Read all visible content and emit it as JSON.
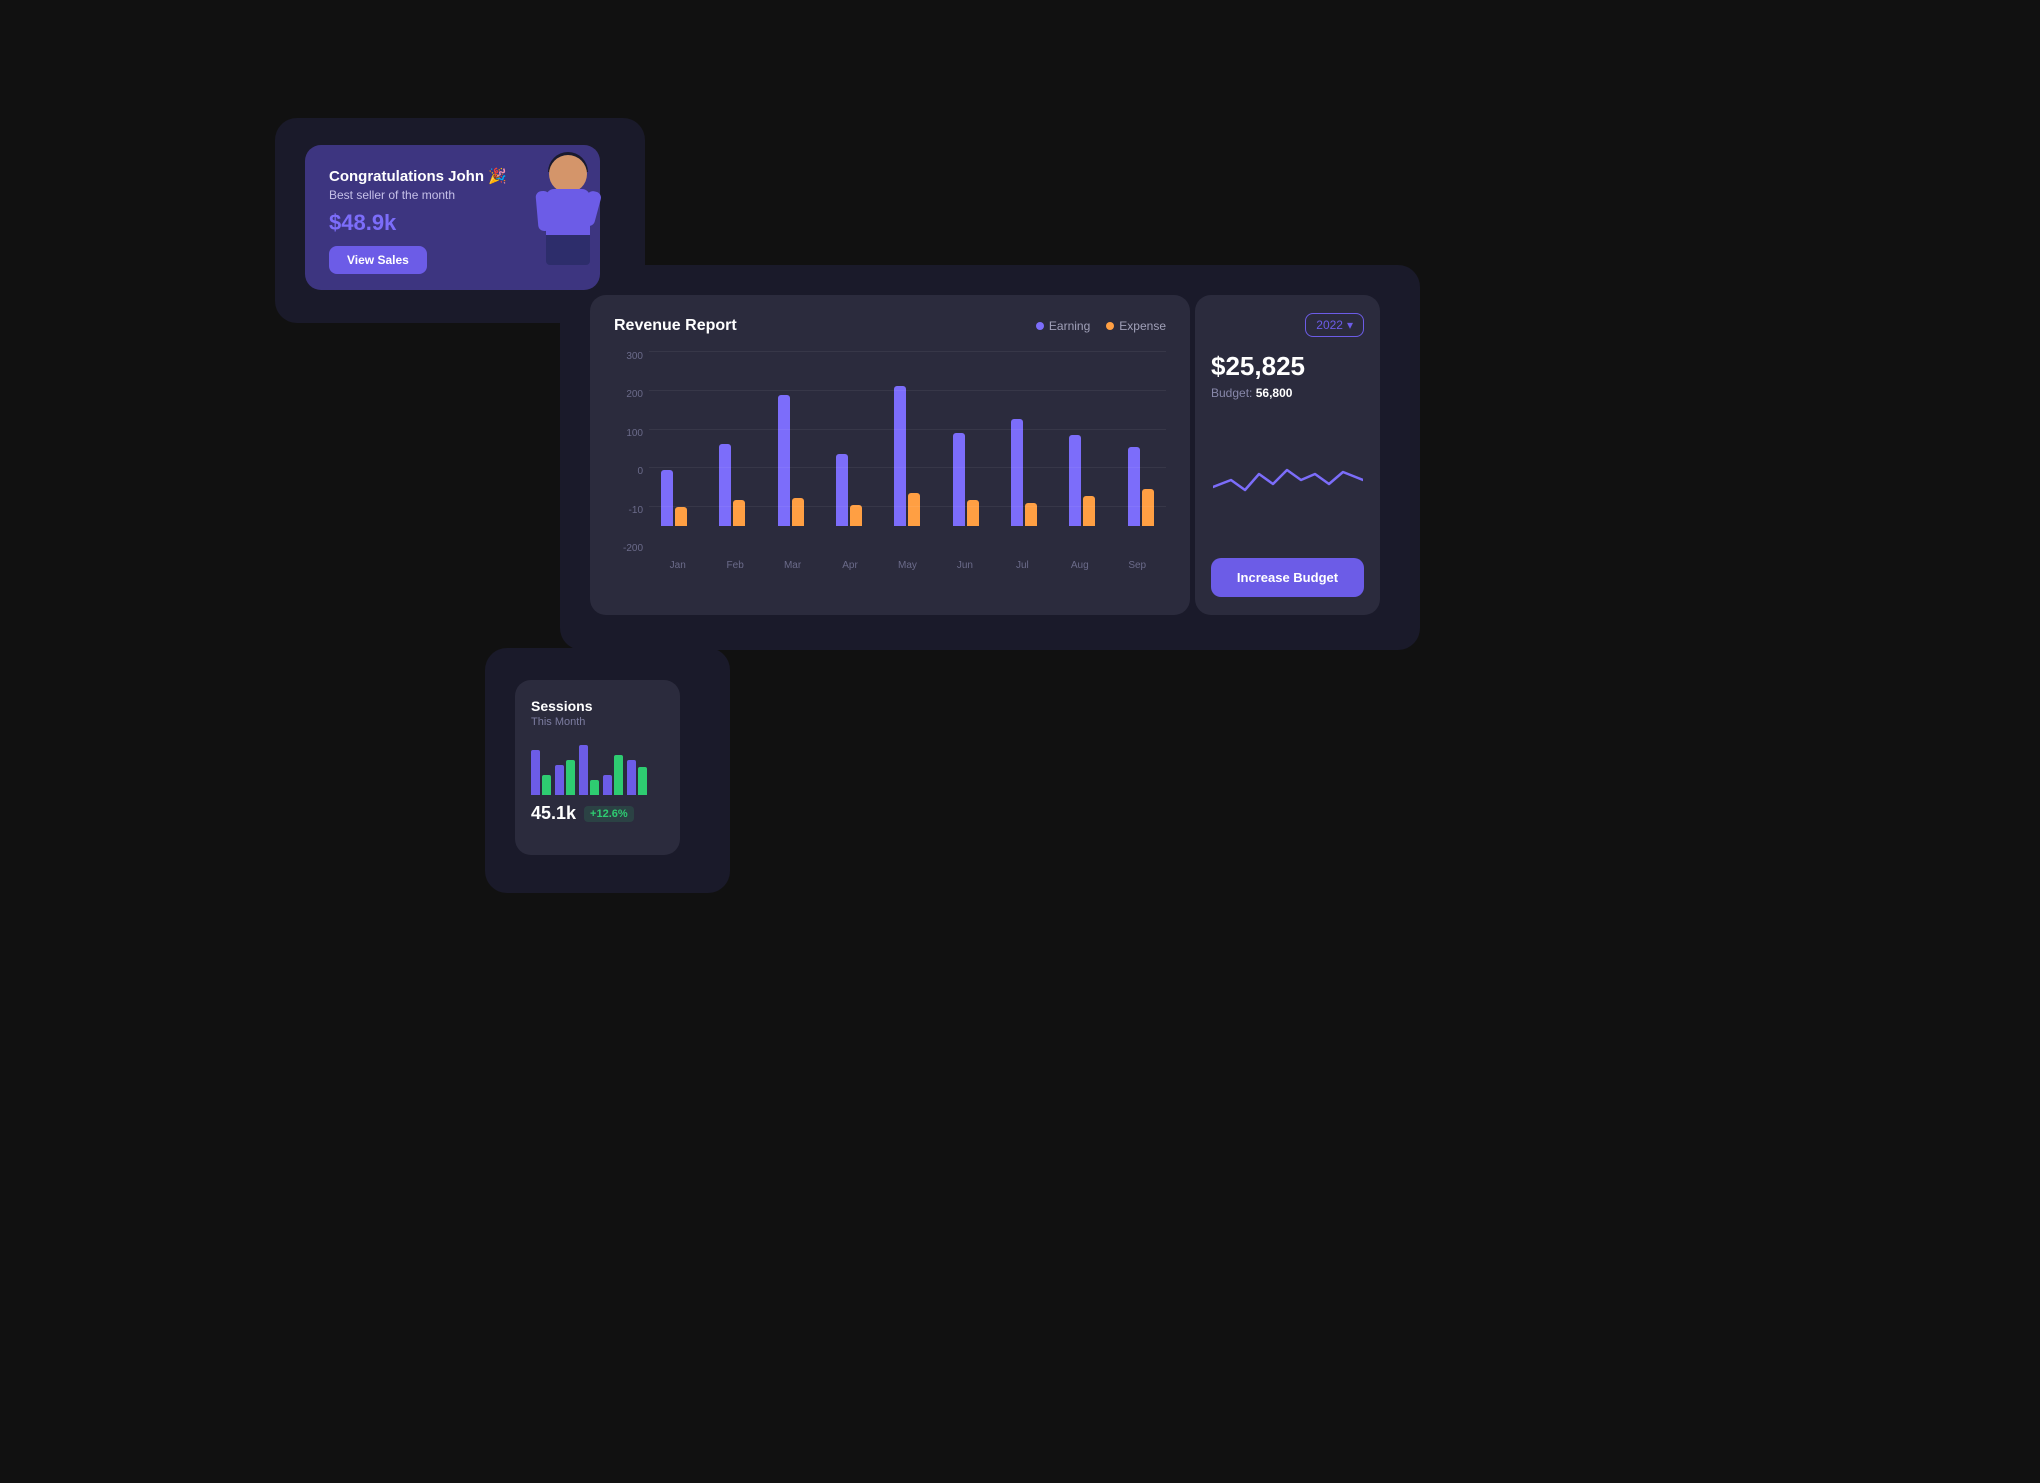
{
  "congrats_card": {
    "title": "Congratulations John 🎉",
    "subtitle": "Best seller of the month",
    "amount": "$48.9k",
    "button_label": "View Sales"
  },
  "revenue_card": {
    "title": "Revenue Report",
    "legend": {
      "earning_label": "Earning",
      "expense_label": "Expense"
    },
    "y_axis": [
      "300",
      "200",
      "100",
      "0",
      "-10",
      "-200"
    ],
    "months": [
      "Jan",
      "Feb",
      "Mar",
      "Apr",
      "May",
      "Jun",
      "Jul",
      "Aug",
      "Sep"
    ],
    "bars": [
      {
        "earn": 120,
        "exp": 40
      },
      {
        "earn": 175,
        "exp": 55
      },
      {
        "earn": 280,
        "exp": 60
      },
      {
        "earn": 155,
        "exp": 45
      },
      {
        "earn": 300,
        "exp": 70
      },
      {
        "earn": 200,
        "exp": 55
      },
      {
        "earn": 230,
        "exp": 50
      },
      {
        "earn": 195,
        "exp": 65
      },
      {
        "earn": 170,
        "exp": 80
      }
    ]
  },
  "revenue_right": {
    "year": "2022",
    "amount": "$25,825",
    "budget_label": "Budget:",
    "budget_value": "56,800",
    "button_label": "Increase Budget"
  },
  "sessions_card": {
    "title": "Sessions",
    "subtitle": "This Month",
    "count": "45.1k",
    "change": "+12.6%",
    "bars": [
      {
        "blue": 45,
        "green": 20
      },
      {
        "blue": 30,
        "green": 35
      },
      {
        "blue": 50,
        "green": 15
      },
      {
        "blue": 20,
        "green": 40
      },
      {
        "blue": 35,
        "green": 28
      }
    ]
  }
}
